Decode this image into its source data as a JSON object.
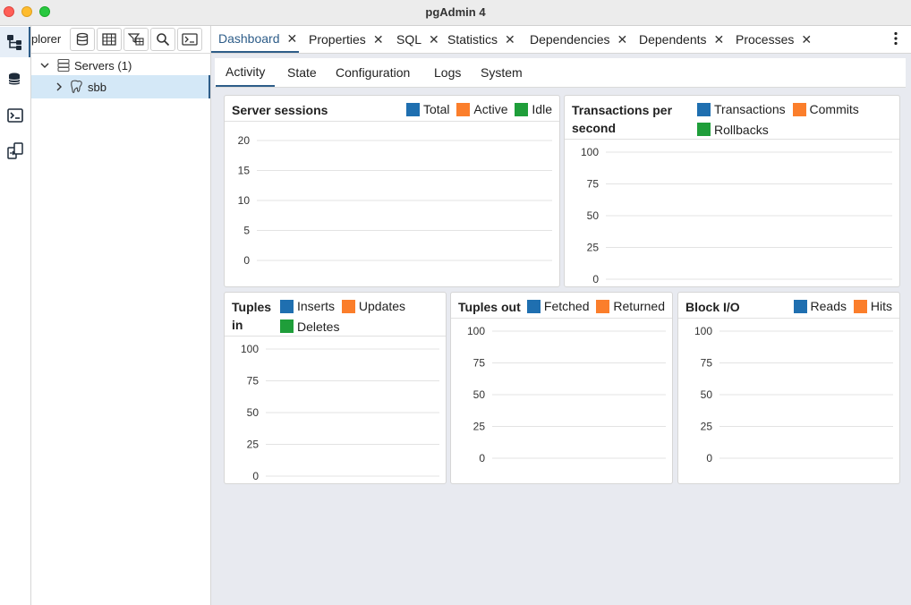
{
  "app": {
    "title": "pgAdmin 4"
  },
  "explorer": {
    "title": "plorer",
    "tree": [
      {
        "label": "Servers (1)",
        "expanded": true
      },
      {
        "label": "sbb",
        "expanded": false
      }
    ]
  },
  "tabs": [
    "Dashboard",
    "Properties",
    "SQL",
    "Statistics",
    "Dependencies",
    "Dependents",
    "Processes"
  ],
  "subtabs": [
    "Activity",
    "State",
    "Configuration",
    "Logs",
    "System"
  ],
  "colors": {
    "blue": "#1f6fb0",
    "orange": "#fb7e2b",
    "green": "#1f9e3a",
    "accent": "#2e5d89"
  },
  "panels": {
    "server_sessions": {
      "title": "Server sessions",
      "legend": [
        "Total",
        "Active",
        "Idle"
      ],
      "ticks": [
        "20",
        "15",
        "10",
        "5",
        "0"
      ]
    },
    "transactions": {
      "title_line1": "Transactions per",
      "title_line2": "second",
      "legend": [
        "Transactions",
        "Commits",
        "Rollbacks"
      ],
      "ticks": [
        "100",
        "75",
        "50",
        "25",
        "0"
      ]
    },
    "tuples_in": {
      "title_line1": "Tuples",
      "title_line2": "in",
      "legend": [
        "Inserts",
        "Updates",
        "Deletes"
      ],
      "ticks": [
        "100",
        "75",
        "50",
        "25",
        "0"
      ]
    },
    "tuples_out": {
      "title": "Tuples out",
      "legend": [
        "Fetched",
        "Returned"
      ],
      "ticks": [
        "100",
        "75",
        "50",
        "25",
        "0"
      ]
    },
    "block_io": {
      "title": "Block I/O",
      "legend": [
        "Reads",
        "Hits"
      ],
      "ticks": [
        "100",
        "75",
        "50",
        "25",
        "0"
      ]
    }
  }
}
